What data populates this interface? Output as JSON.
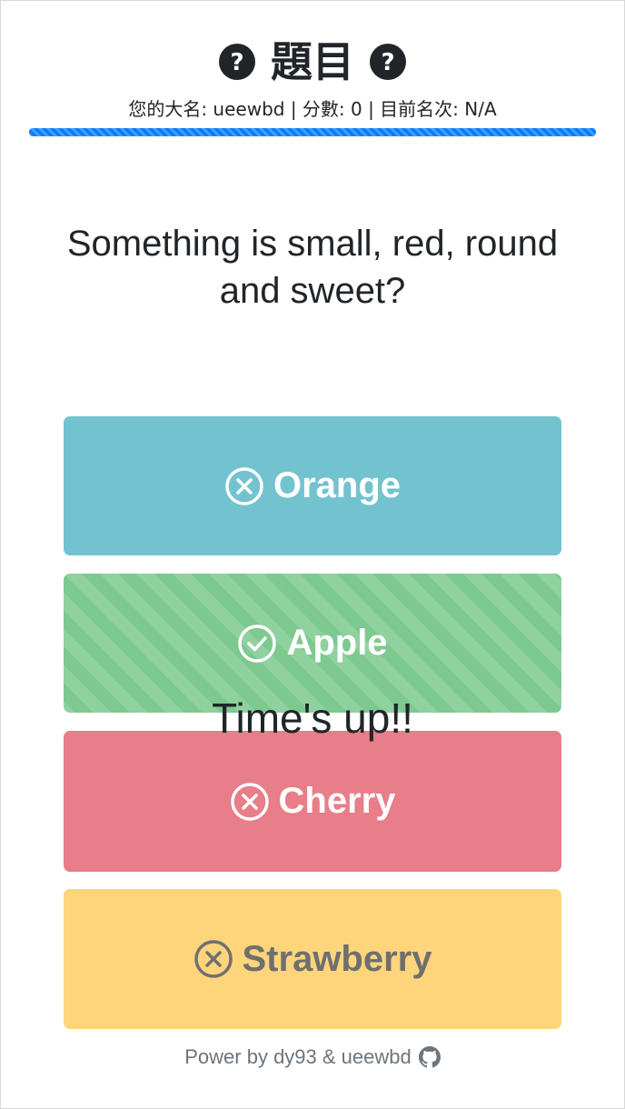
{
  "header": {
    "title": "題目",
    "left_icon": "question-circle-icon",
    "right_icon": "question-circle-icon",
    "status": "您的大名: ueewbd | 分數: 0 | 目前名次: N/A",
    "progress_percent": 100,
    "progress_color": "#007bff"
  },
  "question": {
    "text": "Something is small, red, round and sweet?"
  },
  "choices": [
    {
      "label": "Orange",
      "icon": "x-circle-icon",
      "color": "#72c3cf",
      "state": "incorrect"
    },
    {
      "label": "Apple",
      "icon": "check-circle-icon",
      "color": "#7dc98f",
      "state": "correct"
    },
    {
      "label": "Cherry",
      "icon": "x-circle-icon",
      "color": "#e77e89",
      "state": "incorrect"
    },
    {
      "label": "Strawberry",
      "icon": "x-circle-icon",
      "color": "#fed57b",
      "state": "incorrect"
    }
  ],
  "overlay": {
    "text": "Time's up!!"
  },
  "footer": {
    "text": "Power by dy93 & ueewbd",
    "icon": "github-icon"
  }
}
